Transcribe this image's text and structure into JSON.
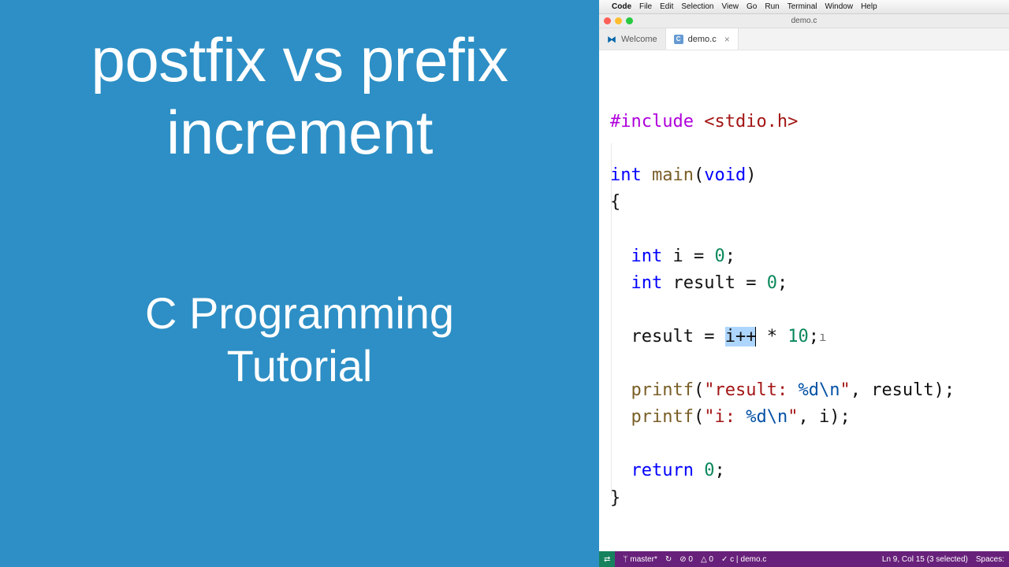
{
  "slide": {
    "title_line1": "postfix vs prefix",
    "title_line2": "increment",
    "subtitle_line1": "C Programming",
    "subtitle_line2": "Tutorial"
  },
  "mac_menu": {
    "apple": "",
    "app": "Code",
    "items": [
      "File",
      "Edit",
      "Selection",
      "View",
      "Go",
      "Run",
      "Terminal",
      "Window",
      "Help"
    ]
  },
  "window": {
    "title": "demo.c"
  },
  "tabs": [
    {
      "icon": "vs",
      "label": "Welcome",
      "active": false,
      "closable": false
    },
    {
      "icon": "c",
      "icon_text": "C",
      "label": "demo.c",
      "active": true,
      "closable": true
    }
  ],
  "code": {
    "l1": {
      "directive": "#include",
      "include": " <stdio.h>"
    },
    "l3": {
      "type": "int",
      "func": " main",
      "paren_open": "(",
      "void": "void",
      "paren_close": ")"
    },
    "l4": "{",
    "l6": {
      "indent": "  ",
      "type": "int",
      "rest": " i = ",
      "num": "0",
      "semi": ";"
    },
    "l7": {
      "indent": "  ",
      "type": "int",
      "rest": " result = ",
      "num": "0",
      "semi": ";"
    },
    "l9": {
      "indent": "  ",
      "lhs": "result = ",
      "sel": "i++",
      "rest_after": " * ",
      "num": "10",
      "semi": ";",
      "ibeam": "ı"
    },
    "l11": {
      "indent": "  ",
      "func": "printf",
      "open": "(",
      "q1": "\"",
      "txt1": "result: ",
      "fmt": "%d",
      "esc": "\\n",
      "q2": "\"",
      "rest": ", result);"
    },
    "l12": {
      "indent": "  ",
      "func": "printf",
      "open": "(",
      "q1": "\"",
      "txt1": "i: ",
      "fmt": "%d",
      "esc": "\\n",
      "q2": "\"",
      "rest": ", i);"
    },
    "l14": {
      "indent": "  ",
      "kw": "return",
      "sp": " ",
      "num": "0",
      "semi": ";"
    },
    "l15": "}"
  },
  "statusbar": {
    "remote_icon": "⇄",
    "branch": "master*",
    "sync": "↻",
    "errors": "⊘ 0",
    "warnings": "△ 0",
    "check": "✓ c |",
    "filename": "demo.c",
    "cursor": "Ln 9, Col 15 (3 selected)",
    "spaces": "Spaces:"
  }
}
